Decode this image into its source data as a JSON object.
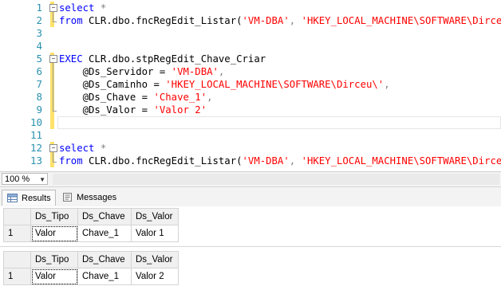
{
  "editor": {
    "lines": [
      {
        "num": "1"
      },
      {
        "num": "2"
      },
      {
        "num": "3"
      },
      {
        "num": "4"
      },
      {
        "num": "5"
      },
      {
        "num": "6"
      },
      {
        "num": "7"
      },
      {
        "num": "8"
      },
      {
        "num": "9"
      },
      {
        "num": "10"
      },
      {
        "num": "11"
      },
      {
        "num": "12"
      },
      {
        "num": "13"
      }
    ],
    "code": {
      "l1_kw": "select",
      "l1_rest": " *",
      "l2_kw": "from",
      "l2_obj": " CLR.dbo.fncRegEdit_Listar(",
      "l2_s1": "'VM-DBA'",
      "l2_comma": ", ",
      "l2_s2": "'HKEY_LOCAL_MACHINE\\SOFTWARE\\Dirceu'",
      "l2_end": ")",
      "l5_kw": "EXEC",
      "l5_obj": " CLR.dbo.stpRegEdit_Chave_Criar",
      "l6_param": "    @Ds_Servidor = ",
      "l6_val": "'VM-DBA'",
      "l6_end": ",",
      "l7_param": "    @Ds_Caminho = ",
      "l7_val": "'HKEY_LOCAL_MACHINE\\SOFTWARE\\Dirceu\\'",
      "l7_end": ",",
      "l8_param": "    @Ds_Chave = ",
      "l8_val": "'Chave_1'",
      "l8_end": ",",
      "l9_param": "    @Ds_Valor = ",
      "l9_val": "'Valor 2'",
      "l12_kw": "select",
      "l12_rest": " *",
      "l13_kw": "from",
      "l13_obj": " CLR.dbo.fncRegEdit_Listar(",
      "l13_s1": "'VM-DBA'",
      "l13_comma": ", ",
      "l13_s2": "'HKEY_LOCAL_MACHINE\\SOFTWARE\\Dirceu'",
      "l13_end": ")"
    }
  },
  "zoom": {
    "value": "100 %"
  },
  "tabs": {
    "results": "Results",
    "messages": "Messages"
  },
  "grids": [
    {
      "columns": [
        "Ds_Tipo",
        "Ds_Chave",
        "Ds_Valor"
      ],
      "rownum": "1",
      "row": [
        "Valor",
        "Chave_1",
        "Valor 1"
      ]
    },
    {
      "columns": [
        "Ds_Tipo",
        "Ds_Chave",
        "Ds_Valor"
      ],
      "rownum": "1",
      "row": [
        "Valor",
        "Chave_1",
        "Valor 2"
      ]
    }
  ],
  "colors": {
    "keyword": "#0000ff",
    "string": "#ff0000",
    "line_number": "#2b91af",
    "change_bar": "#ffe26a"
  }
}
